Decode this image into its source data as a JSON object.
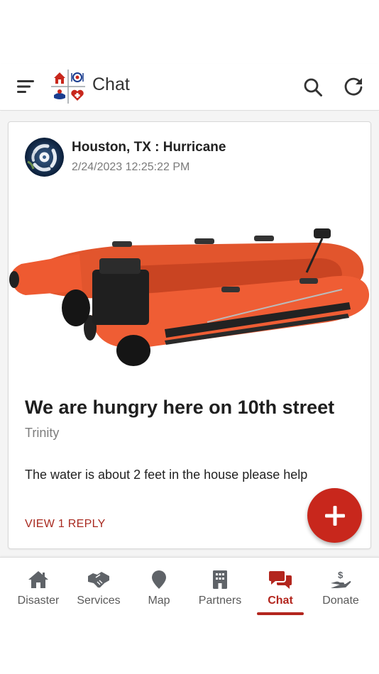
{
  "app": {
    "title": "Chat"
  },
  "post": {
    "location_title": "Houston, TX : Hurricane",
    "timestamp": "2/24/2023 12:25:22 PM",
    "title": "We are hungry here on 10th street",
    "author": "Trinity",
    "body": "The water is about 2 feet in the house please help",
    "reply_link": "VIEW 1 REPLY"
  },
  "nav": {
    "items": [
      {
        "label": "Disaster",
        "icon": "home-icon"
      },
      {
        "label": "Services",
        "icon": "handshake-icon"
      },
      {
        "label": "Map",
        "icon": "map-pin-icon"
      },
      {
        "label": "Partners",
        "icon": "building-icon"
      },
      {
        "label": "Chat",
        "icon": "chat-icon"
      },
      {
        "label": "Donate",
        "icon": "donate-icon"
      }
    ],
    "active": "Chat"
  },
  "colors": {
    "accent": "#b3261e",
    "fab": "#c8271c",
    "icon_gray": "#5f6368"
  }
}
